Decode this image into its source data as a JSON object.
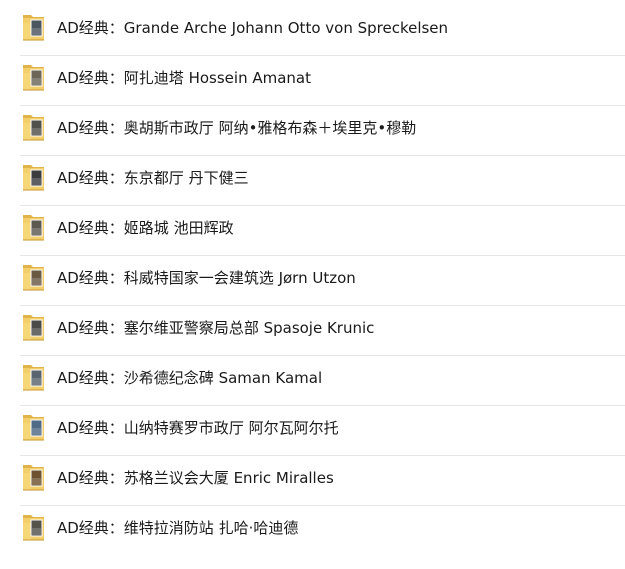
{
  "folders": [
    {
      "name": "AD经典：Grande Arche Johann Otto von Spreckelsen",
      "icon": "folder-thumbnail-icon",
      "thumb": "#4a5560"
    },
    {
      "name": "AD经典：阿扎迪塔 Hossein Amanat",
      "icon": "folder-thumbnail-icon",
      "thumb": "#6b6658"
    },
    {
      "name": "AD经典：奥胡斯市政厅 阿纳•雅格布森＋埃里克•穆勒",
      "icon": "folder-thumbnail-icon",
      "thumb": "#52504a"
    },
    {
      "name": "AD经典：东京都厅 丹下健三",
      "icon": "folder-thumbnail-icon",
      "thumb": "#3a3c40"
    },
    {
      "name": "AD经典：姬路城 池田辉政",
      "icon": "folder-thumbnail-icon",
      "thumb": "#5c5a50"
    },
    {
      "name": "AD经典：科威特国家一会建筑选 Jørn Utzon",
      "icon": "folder-thumbnail-icon",
      "thumb": "#6a5a44"
    },
    {
      "name": "AD经典：塞尔维亚警察局总部 Spasoje Krunic",
      "icon": "folder-thumbnail-icon",
      "thumb": "#4c4a48"
    },
    {
      "name": "AD经典：沙希德纪念碑 Saman Kamal",
      "icon": "folder-thumbnail-icon",
      "thumb": "#5a6470"
    },
    {
      "name": "AD经典：山纳特赛罗市政厅 阿尔瓦阿尔托",
      "icon": "folder-thumbnail-icon",
      "thumb": "#4f6a86"
    },
    {
      "name": "AD经典：苏格兰议会大厦 Enric Miralles",
      "icon": "folder-thumbnail-icon",
      "thumb": "#6e5230"
    },
    {
      "name": "AD经典：维特拉消防站 扎哈·哈迪德",
      "icon": "folder-thumbnail-icon",
      "thumb": "#55524c"
    }
  ]
}
